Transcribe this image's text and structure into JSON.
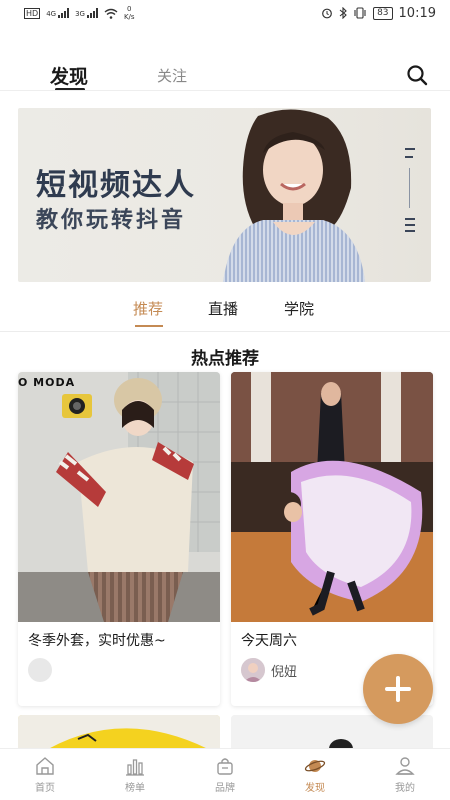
{
  "status_bar": {
    "left_label": "HD",
    "sig1_label": "4G",
    "sig2_label": "3G",
    "speed_value": "0",
    "speed_unit": "K/s",
    "battery": "83",
    "time": "10:19"
  },
  "top_nav": {
    "tabs": [
      {
        "label": "发现",
        "active": true
      },
      {
        "label": "关注",
        "active": false
      }
    ],
    "search_icon": "search-icon"
  },
  "banner": {
    "title": "短视频达人",
    "subtitle": "教你玩转抖音"
  },
  "sub_tabs": [
    {
      "label": "推荐",
      "active": true
    },
    {
      "label": "直播",
      "active": false
    },
    {
      "label": "学院",
      "active": false
    }
  ],
  "section_title": "热点推荐",
  "cards": [
    {
      "brand": "O MODA",
      "caption": "冬季外套，实时优惠~",
      "author": ""
    },
    {
      "caption": "今天周六",
      "author": "倪妞"
    }
  ],
  "colors": {
    "accent": "#c48a53",
    "fab": "#d59a5e",
    "banner_text": "#2f3b4f"
  },
  "bottom_nav": [
    {
      "label": "首页",
      "icon": "home-icon",
      "active": false
    },
    {
      "label": "榜单",
      "icon": "chart-icon",
      "active": false
    },
    {
      "label": "品牌",
      "icon": "bag-icon",
      "active": false
    },
    {
      "label": "发现",
      "icon": "planet-icon",
      "active": true
    },
    {
      "label": "我的",
      "icon": "profile-icon",
      "active": false
    }
  ]
}
